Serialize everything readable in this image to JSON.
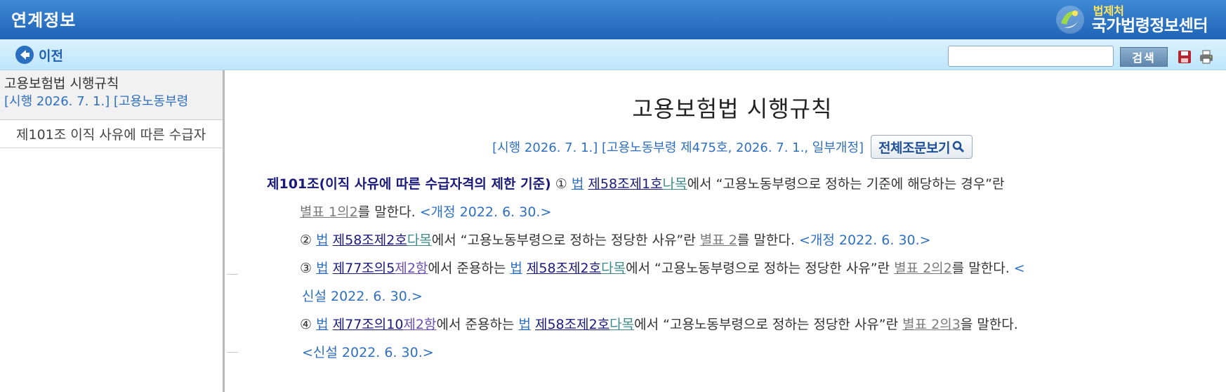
{
  "header": {
    "title": "연계정보",
    "brand_sub": "법제처",
    "brand_main": "국가법령정보센터"
  },
  "toolbar": {
    "back_label": "이전",
    "search_value": "",
    "search_button": "검색",
    "save_icon": "save-icon",
    "print_icon": "print-icon"
  },
  "sidebar": {
    "root_title": "고용보험법 시행규칙",
    "root_meta": "[시행 2026. 7. 1.] [고용노동부령",
    "items": [
      {
        "label": "제101조 이직 사유에 따른 수급자"
      }
    ]
  },
  "law": {
    "title": "고용보험법 시행규칙",
    "meta": "[시행 2026. 7. 1.] [고용노동부령 제475호, 2026. 7. 1., 일부개정]",
    "view_all_label": "전체조문보기"
  },
  "article": {
    "heading": "제101조(이직 사유에 따른 수급자격의 제한 기준)",
    "p1": {
      "num": "①",
      "law": "법",
      "ref": "제58조제1호",
      "ref_sub": "나목",
      "text1": "에서 “고용노동부령으로 정하는 기준에 해당하는 경우”란",
      "table": "별표 1의2",
      "text2": "를 말한다.",
      "amend": "<개정 2022. 6. 30.>"
    },
    "p2": {
      "num": "②",
      "law": "법",
      "ref": "제58조제2호",
      "ref_sub": "다목",
      "text1": "에서 “고용노동부령으로 정하는 정당한 사유”란",
      "table": "별표 2",
      "text2": "를 말한다.",
      "amend": "<개정 2022. 6. 30.>"
    },
    "p3": {
      "num": "③",
      "law": "법",
      "ref": "제77조의5",
      "ref_sub": "제2항",
      "text1": "에서 준용하는",
      "law2": "법",
      "ref2": "제58조제2호",
      "ref2_sub": "다목",
      "text2": "에서 “고용노동부령으로 정하는 정당한 사유”란",
      "table": "별표 2의2",
      "text3": "를 말한다.",
      "amend_a": "<",
      "amend_b": "신설 2022. 6. 30.>"
    },
    "p4": {
      "num": "④",
      "law": "법",
      "ref": "제77조의10",
      "ref_sub": "제2항",
      "text1": "에서 준용하는",
      "law2": "법",
      "ref2": "제58조제2호",
      "ref2_sub": "다목",
      "text2": "에서 “고용노동부령으로 정하는 정당한 사유”란",
      "table": "별표 2의3",
      "text3": "을 말한다.",
      "amend": "<신설 2022. 6. 30.>"
    }
  }
}
